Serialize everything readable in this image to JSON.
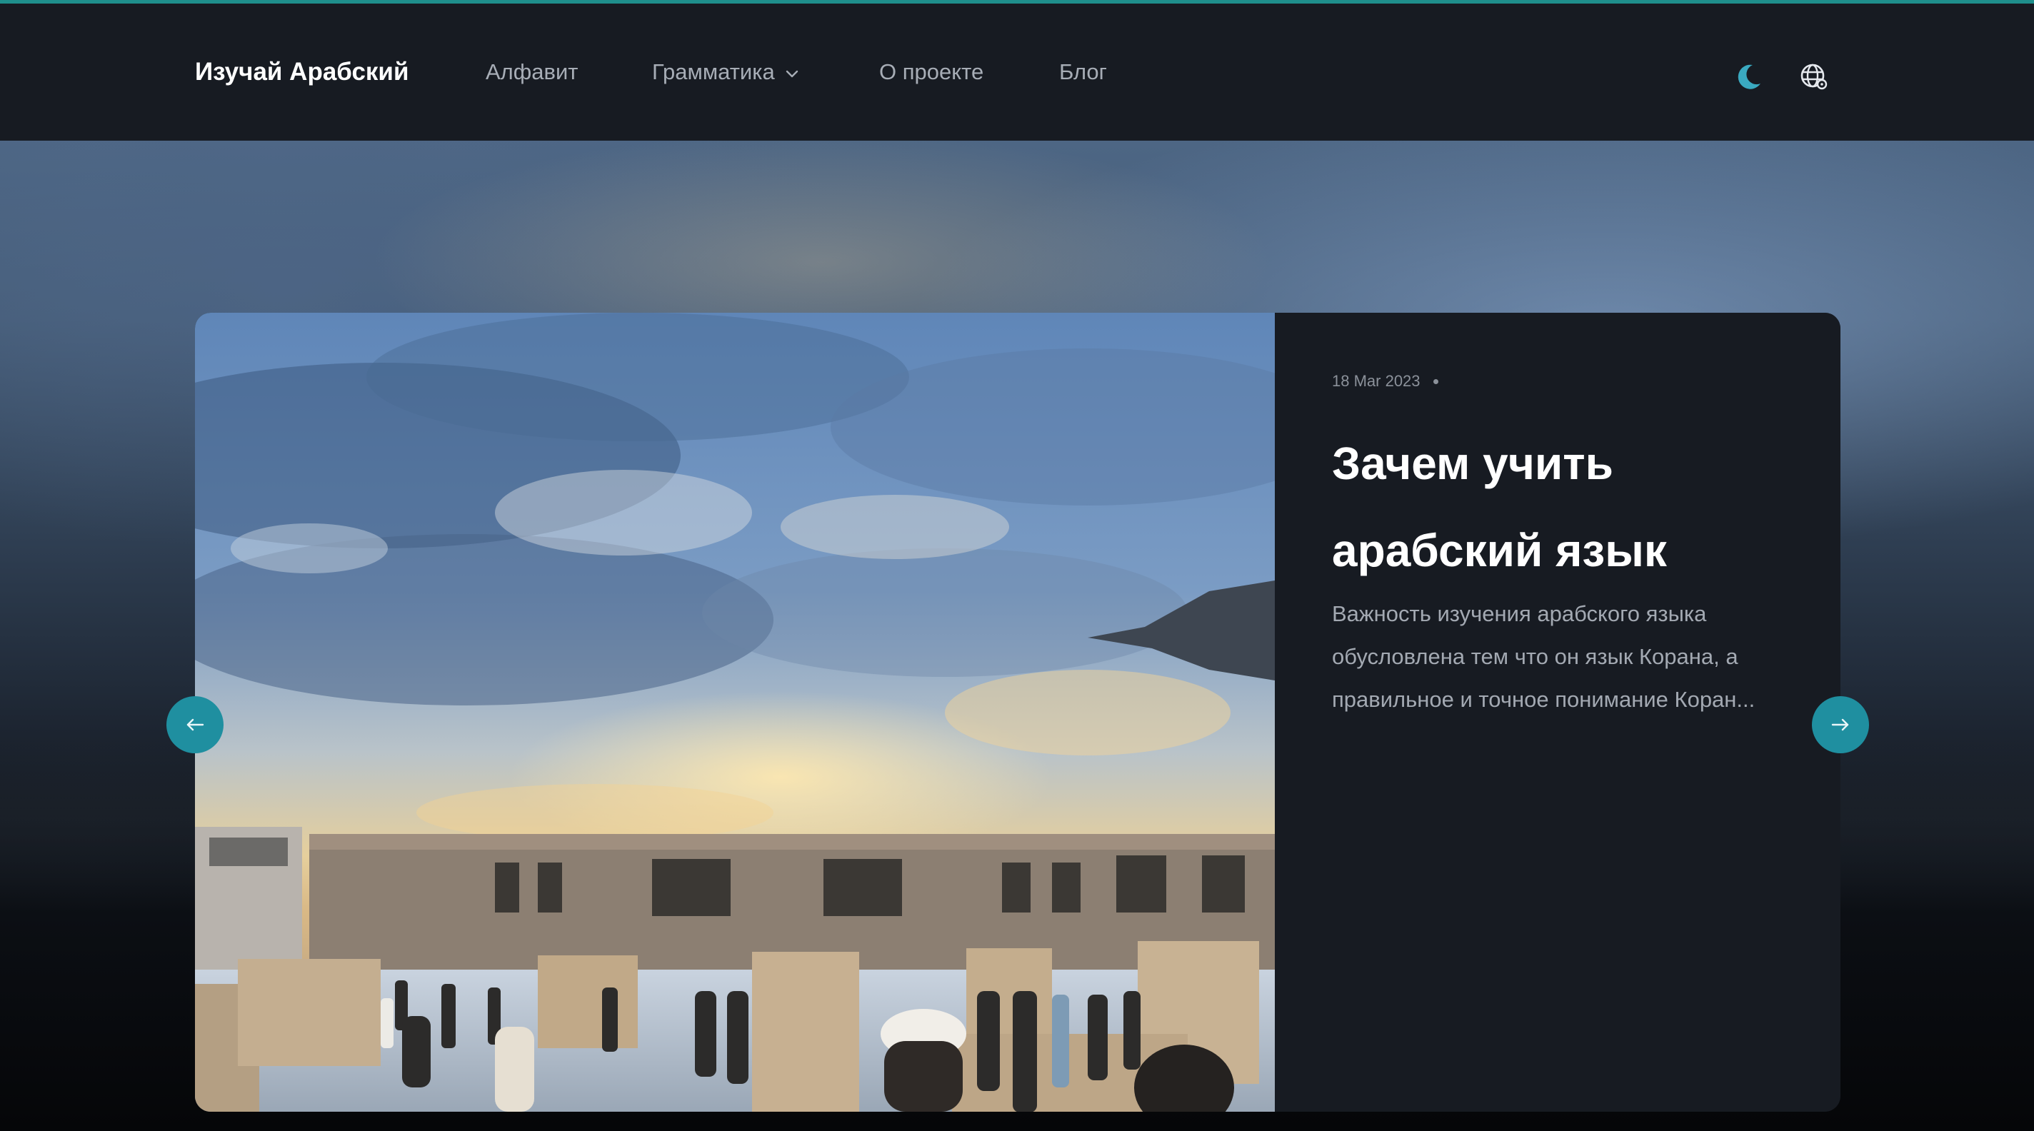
{
  "header": {
    "logo": "Изучай Арабский",
    "nav": [
      {
        "label": "Алфавит"
      },
      {
        "label": "Грамматика",
        "has_dropdown": true
      },
      {
        "label": "О проекте"
      },
      {
        "label": "Блог"
      }
    ],
    "icons": [
      "moon-icon",
      "globe-icon"
    ]
  },
  "featured_post": {
    "date": "18 Mar 2023",
    "title": "Зачем учить арабский язык",
    "excerpt": "Важность изучения арабского языка обусловлена тем что он язык Корана, а правильное и точное понимание Коран..."
  },
  "slider": {
    "prev_icon": "arrow-left-icon",
    "next_icon": "arrow-right-icon"
  },
  "colors": {
    "accent": "#1f8f8c",
    "arrow_button": "#1f8fa0",
    "moon_icon": "#3aa9c0",
    "header_bg": "#171b22",
    "card_bg": "#171b22",
    "nav_text": "#a7adb6"
  }
}
